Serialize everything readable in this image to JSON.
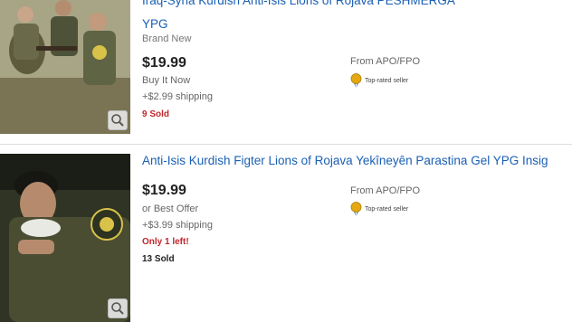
{
  "listings": [
    {
      "title_line1": "Iraq-Syria Kurdish Anti-Isis Lions of Rojava PESHMERGA",
      "title_line2": "YPG",
      "condition": "Brand New",
      "price": "$19.99",
      "format": "Buy It Now",
      "shipping": "+$2.99 shipping",
      "sold": "9 Sold",
      "from": "From APO/FPO",
      "seller_badge": "Top-rated seller"
    },
    {
      "title": "Anti-Isis Kurdish Figter Lions of Rojava Yekîneyên Parastina Gel YPG Insig",
      "price": "$19.99",
      "format": "or Best Offer",
      "shipping": "+$3.99 shipping",
      "remaining": "Only 1 left!",
      "sold": "13 Sold",
      "from": "From APO/FPO",
      "seller_badge": "Top-rated seller"
    }
  ],
  "icons": {
    "zoom": "magnifier-icon",
    "seller": "top-rated-medal-icon"
  },
  "colors": {
    "link": "#1a5fb4",
    "alert": "#c0272d",
    "medal": "#e3a812"
  }
}
